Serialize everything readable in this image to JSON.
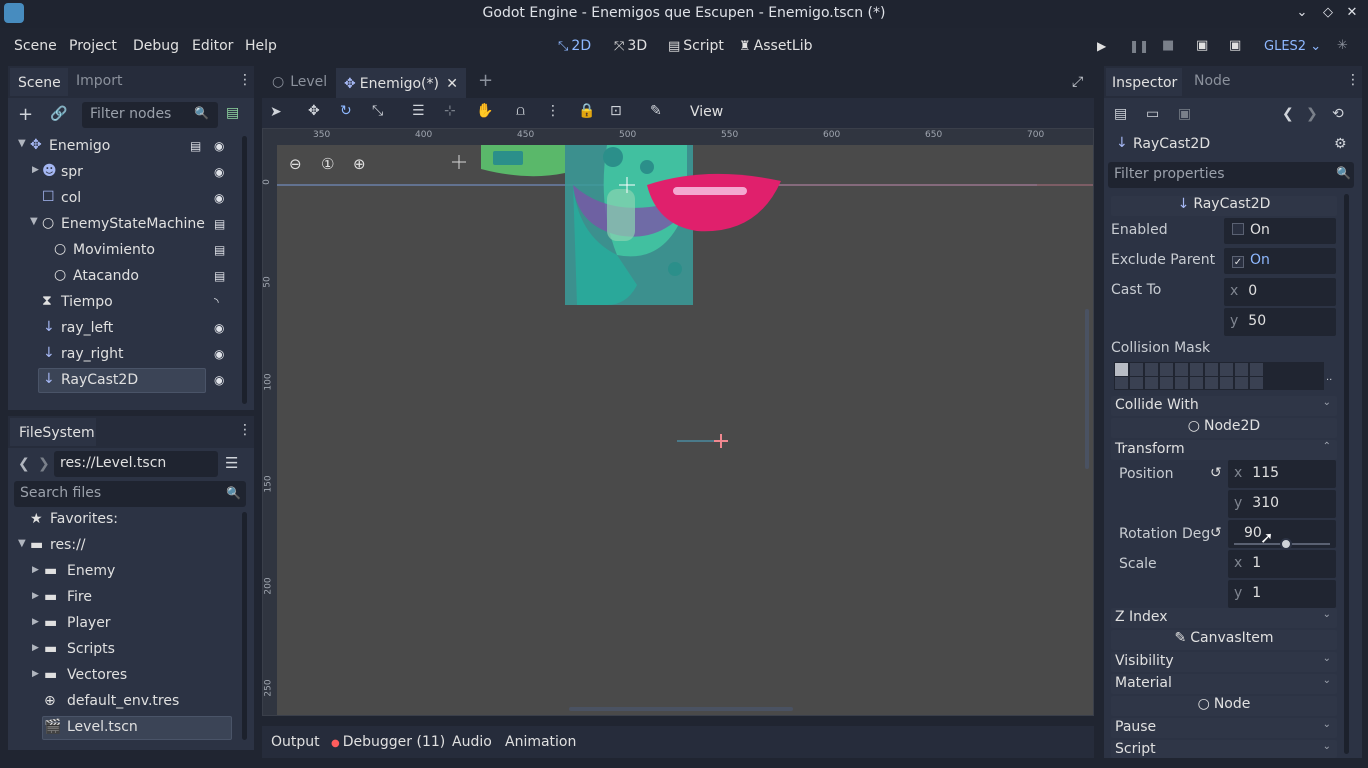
{
  "window": {
    "title": "Godot Engine - Enemigos que Escupen - Enemigo.tscn (*)"
  },
  "menu": {
    "items": [
      "Scene",
      "Project",
      "Debug",
      "Editor",
      "Help"
    ]
  },
  "workspaces": {
    "items": [
      "2D",
      "3D",
      "Script",
      "AssetLib"
    ],
    "active": "2D"
  },
  "renderer": "GLES2",
  "scene_dock": {
    "tabs": [
      "Scene",
      "Import"
    ],
    "filter_placeholder": "Filter nodes",
    "nodes": [
      {
        "name": "Enemigo",
        "icon": "node2d-icon",
        "visible": true,
        "script": true,
        "depth": 0
      },
      {
        "name": "spr",
        "icon": "sprite-icon",
        "visible": true,
        "depth": 1
      },
      {
        "name": "col",
        "icon": "collision-shape-icon",
        "visible": true,
        "depth": 1
      },
      {
        "name": "EnemyStateMachine",
        "icon": "node-icon",
        "script": true,
        "depth": 1
      },
      {
        "name": "Movimiento",
        "icon": "node-icon",
        "script": true,
        "depth": 2
      },
      {
        "name": "Atacando",
        "icon": "node-icon",
        "script": true,
        "depth": 2
      },
      {
        "name": "Tiempo",
        "icon": "timer-icon",
        "signal": true,
        "depth": 1
      },
      {
        "name": "ray_left",
        "icon": "raycast-icon",
        "visible": true,
        "depth": 1
      },
      {
        "name": "ray_right",
        "icon": "raycast-icon",
        "visible": true,
        "depth": 1
      },
      {
        "name": "RayCast2D",
        "icon": "raycast-icon",
        "visible": true,
        "depth": 1,
        "selected": true
      }
    ]
  },
  "filesystem": {
    "tab": "FileSystem",
    "path": "res://Level.tscn",
    "search_placeholder": "Search files",
    "favorites": "Favorites:",
    "root": "res://",
    "folders": [
      "Enemy",
      "Fire",
      "Player",
      "Scripts",
      "Vectores"
    ],
    "files": [
      "default_env.tres",
      "Level.tscn"
    ]
  },
  "editor_tabs": [
    {
      "label": "Level",
      "active": false
    },
    {
      "label": "Enemigo(*)",
      "active": true
    }
  ],
  "toolbar": {
    "view_label": "View"
  },
  "ruler": {
    "h_ticks": [
      "350",
      "400",
      "450",
      "500",
      "550",
      "600",
      "650",
      "700"
    ],
    "v_ticks": [
      "0",
      "50",
      "100",
      "150",
      "200",
      "250"
    ]
  },
  "bottom_tabs": {
    "output": "Output",
    "debugger": "Debugger (11)",
    "audio": "Audio",
    "animation": "Animation"
  },
  "inspector": {
    "tabs": [
      "Inspector",
      "Node"
    ],
    "node_name": "RayCast2D",
    "filter_placeholder": "Filter properties",
    "class_header": "RayCast2D",
    "enabled": {
      "label": "Enabled",
      "value": "On",
      "checked": false
    },
    "exclude_parent": {
      "label": "Exclude Parent",
      "value": "On",
      "checked": true
    },
    "cast_to": {
      "label": "Cast To",
      "x": "0",
      "y": "50"
    },
    "collision_mask": {
      "label": "Collision Mask",
      "more": ".."
    },
    "collide_with": "Collide With",
    "node2d_header": "Node2D",
    "transform": "Transform",
    "position": {
      "label": "Position",
      "x": "115",
      "y": "310"
    },
    "rotation": {
      "label": "Rotation Deg",
      "value": "90"
    },
    "scale": {
      "label": "Scale",
      "x": "1",
      "y": "1"
    },
    "z_index": "Z Index",
    "canvasitem_header": "CanvasItem",
    "visibility": "Visibility",
    "material": "Material",
    "node_header": "Node",
    "pause": "Pause",
    "script": "Script"
  }
}
